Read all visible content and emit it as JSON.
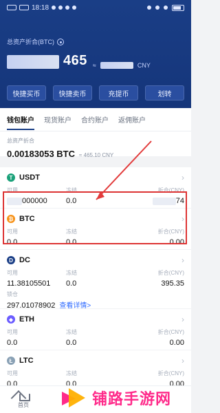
{
  "statusbar": {
    "time": "18:18",
    "icons_left": [
      "signal-icon",
      "signal-icon",
      "message-icon",
      "camera-icon",
      "chat-icon",
      "dot-icon"
    ],
    "icons_right": [
      "notification-icon",
      "alarm-icon",
      "wifi-icon",
      "battery-icon"
    ]
  },
  "header": {
    "total_label": "总资产折合(BTC)",
    "total_value_visible_part": "465",
    "approx": "≈",
    "currency": "CNY",
    "actions": [
      "快捷买币",
      "快捷卖币",
      "充提币",
      "划转"
    ]
  },
  "tabs": [
    "钱包账户",
    "现货账户",
    "合约账户",
    "返佣账户"
  ],
  "summary": {
    "label": "总资产折合",
    "value": "0.00183053 BTC",
    "approx": "≈ 465.10 CNY"
  },
  "columns": {
    "available": "可用",
    "frozen": "冻结",
    "converted": "折合(CNY)"
  },
  "coins": [
    {
      "symbol": "USDT",
      "icon": "tether-icon",
      "available": "000000",
      "frozen": "0.0",
      "converted": "74"
    },
    {
      "symbol": "BTC",
      "icon": "bitcoin-icon",
      "available": "0.0",
      "frozen": "0.0",
      "converted": "0.00"
    },
    {
      "symbol": "DC",
      "icon": "dc-icon",
      "available": "11.38105501",
      "frozen": "0.0",
      "converted": "395.35",
      "lock_label": "锁仓",
      "lock_value": "297.01078902",
      "details_link": "查看详情>"
    },
    {
      "symbol": "ETH",
      "icon": "ethereum-icon",
      "available": "0.0",
      "frozen": "0.0",
      "converted": "0.00"
    },
    {
      "symbol": "LTC",
      "icon": "litecoin-icon",
      "available": "0.0",
      "frozen": "0.0",
      "converted": "0.00"
    }
  ],
  "bottom_nav": {
    "home_label": "首页"
  },
  "watermark": {
    "text": "铺路手游网"
  },
  "colors": {
    "header_bg": "#1a3e86",
    "accent": "#2f6bff",
    "highlight": "#d33"
  }
}
